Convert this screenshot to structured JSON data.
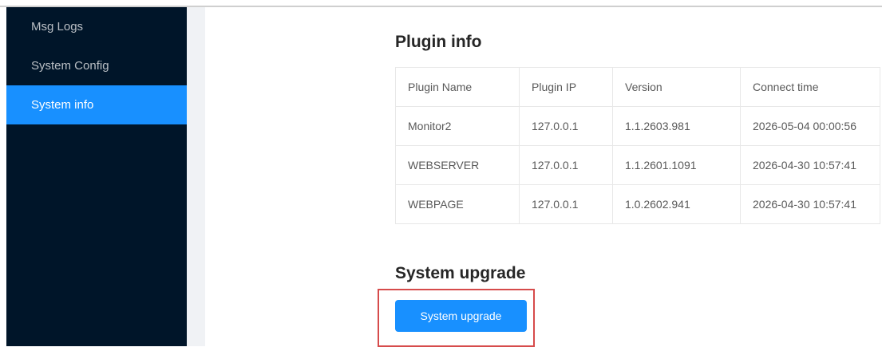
{
  "sidebar": {
    "items": [
      {
        "label": "Msg Logs"
      },
      {
        "label": "System Config"
      },
      {
        "label": "System info"
      }
    ]
  },
  "plugin_info": {
    "title": "Plugin info",
    "columns": [
      "Plugin Name",
      "Plugin IP",
      "Version",
      "Connect time"
    ],
    "rows": [
      [
        "Monitor2",
        "127.0.0.1",
        "1.1.2603.981",
        "2026-05-04 00:00:56"
      ],
      [
        "WEBSERVER",
        "127.0.0.1",
        "1.1.2601.1091",
        "2026-04-30 10:57:41"
      ],
      [
        "WEBPAGE",
        "127.0.0.1",
        "1.0.2602.941",
        "2026-04-30 10:57:41"
      ]
    ]
  },
  "system_upgrade": {
    "title": "System upgrade",
    "button_label": "System upgrade"
  },
  "colors": {
    "sidebar_bg": "#001529",
    "active_item": "#1890ff",
    "highlight_border": "#d64b4b"
  }
}
